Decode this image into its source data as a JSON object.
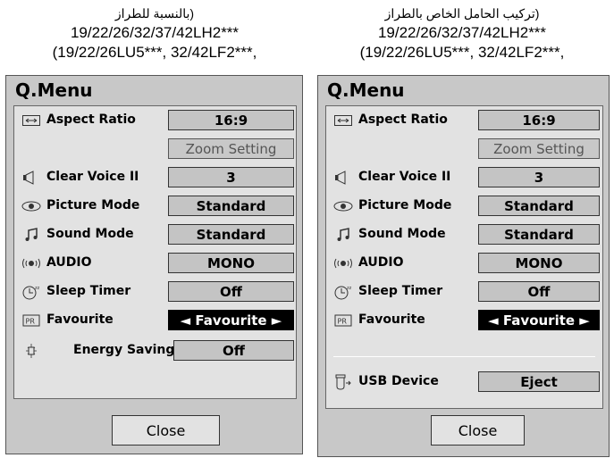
{
  "left": {
    "caption": {
      "line1": "(بالنسبة للطراز",
      "line2": "19/22/26/32/37/42LH2***",
      "line3": "(19/22/26LU5***, 32/42LF2***,"
    },
    "title": "Q.Menu",
    "items": [
      {
        "label": "Aspect Ratio",
        "value": "16:9",
        "icon": "aspect-ratio-icon"
      },
      {
        "label": "",
        "value": "Zoom Setting",
        "icon": ""
      },
      {
        "label": "Clear Voice II",
        "value": "3",
        "icon": "speaker-icon"
      },
      {
        "label": "Picture Mode",
        "value": "Standard",
        "icon": "eye-icon"
      },
      {
        "label": "Sound Mode",
        "value": "Standard",
        "icon": "music-note-icon"
      },
      {
        "label": "AUDIO",
        "value": "MONO",
        "icon": "audio-icon"
      },
      {
        "label": "Sleep Timer",
        "value": "Off",
        "icon": "sleep-timer-icon"
      },
      {
        "label": "Favourite",
        "value": "◄  Favourite  ►",
        "icon": "pr-icon"
      },
      {
        "label": "Energy Saving",
        "value": "Off",
        "icon": "energy-saving-icon"
      }
    ],
    "close_label": "Close"
  },
  "right": {
    "caption": {
      "line1": "(تركيب الحامل الخاص بالطراز",
      "line2": "19/22/26/32/37/42LH2***",
      "line3": "(19/22/26LU5***, 32/42LF2***,"
    },
    "title": "Q.Menu",
    "items": [
      {
        "label": "Aspect Ratio",
        "value": "16:9",
        "icon": "aspect-ratio-icon"
      },
      {
        "label": "",
        "value": "Zoom Setting",
        "icon": ""
      },
      {
        "label": "Clear Voice II",
        "value": "3",
        "icon": "speaker-icon"
      },
      {
        "label": "Picture Mode",
        "value": "Standard",
        "icon": "eye-icon"
      },
      {
        "label": "Sound Mode",
        "value": "Standard",
        "icon": "music-note-icon"
      },
      {
        "label": "AUDIO",
        "value": "MONO",
        "icon": "audio-icon"
      },
      {
        "label": "Sleep Timer",
        "value": "Off",
        "icon": "sleep-timer-icon"
      },
      {
        "label": "Favourite",
        "value": "◄  Favourite  ►",
        "icon": "pr-icon"
      },
      {
        "label": "USB Device",
        "value": "Eject",
        "icon": "usb-device-icon"
      }
    ],
    "close_label": "Close"
  },
  "colors": {
    "panel_bg": "#c8c8c8",
    "inner_bg": "#e2e2e2",
    "value_bg": "#c4c4c4",
    "selected_bg": "#000000",
    "selected_fg": "#ffffff"
  }
}
